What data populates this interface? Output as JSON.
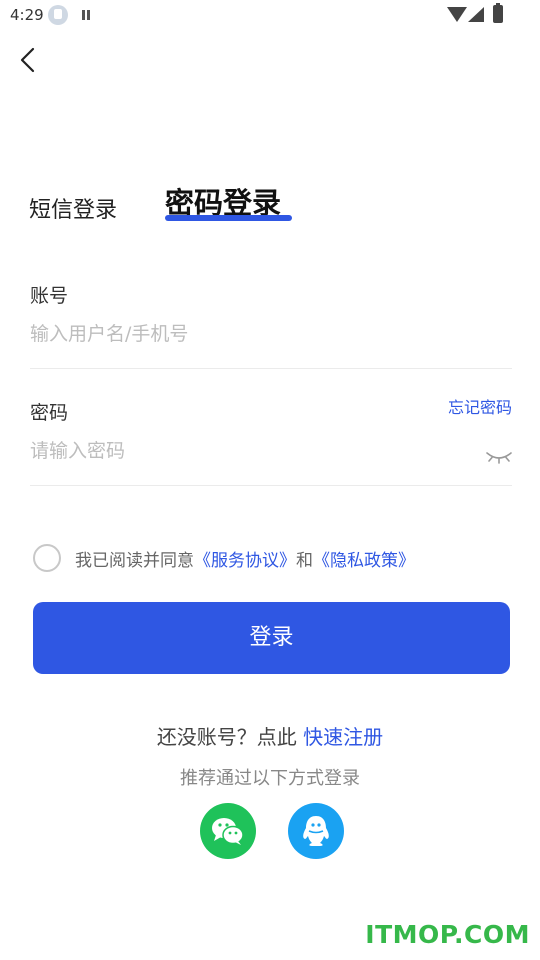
{
  "status_bar": {
    "time": "4:29",
    "icons": [
      "download-icon",
      "pause-icon",
      "wifi-icon",
      "signal-icon",
      "battery-icon"
    ]
  },
  "header": {
    "back_icon": "chevron-left-icon"
  },
  "tabs": [
    {
      "label": "短信登录",
      "active": false
    },
    {
      "label": "密码登录",
      "active": true
    }
  ],
  "form": {
    "account": {
      "label": "账号",
      "placeholder": "输入用户名/手机号",
      "value": ""
    },
    "password": {
      "label": "密码",
      "placeholder": "请输入密码",
      "value": "",
      "forgot_label": "忘记密码",
      "toggle_icon": "eye-closed-icon"
    }
  },
  "agreement": {
    "checked": false,
    "prefix": "我已阅读并同意",
    "service_link": "《服务协议》",
    "conjunction": "和",
    "privacy_link": "《隐私政策》"
  },
  "login_button": {
    "label": "登录"
  },
  "register": {
    "prompt": "还没账号？点此",
    "link": "快速注册"
  },
  "social": {
    "title": "推荐通过以下方式登录",
    "providers": [
      {
        "icon": "wechat-icon",
        "color": "#1fc25a"
      },
      {
        "icon": "qq-icon",
        "color": "#1aa2f2"
      }
    ]
  },
  "watermark": "ITMOP.COM",
  "colors": {
    "accent": "#2f57e3",
    "wechat": "#1fc25a",
    "qq": "#1aa2f2",
    "watermark": "#36b84a"
  }
}
